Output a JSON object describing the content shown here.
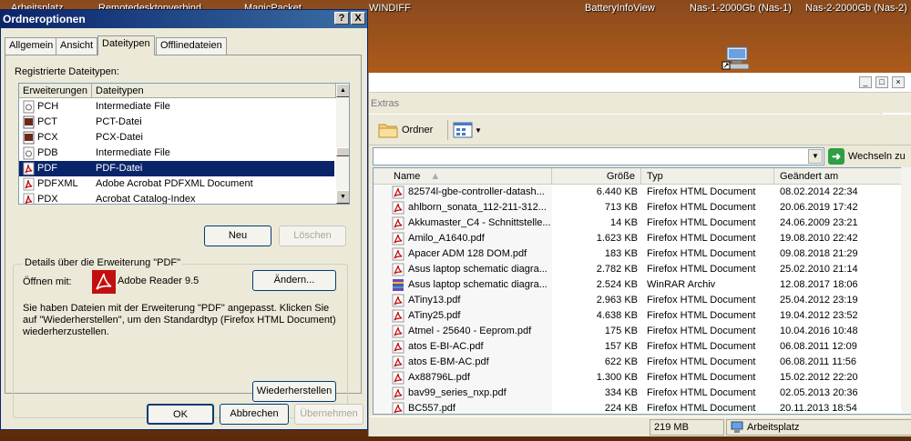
{
  "desktop": {
    "labels": [
      "Arbeitsplatz",
      "Remotedesktopverbind",
      "MagicPacket",
      "WINDIFF",
      "BatteryInfoView",
      "Nas-1-2000Gb (Nas-1)",
      "Nas-2-2000Gb (Nas-2)"
    ]
  },
  "explorer": {
    "menu_partial": "Extras",
    "toolbar": {
      "folders_label": "Ordner"
    },
    "address": {
      "go_label": "Wechseln zu"
    },
    "columns": {
      "name": "Name",
      "size": "Größe",
      "type": "Typ",
      "modified": "Geändert am"
    },
    "files": [
      {
        "name": "82574l-gbe-controller-datash...",
        "size": "6.440 KB",
        "type": "Firefox HTML Document",
        "modified": "08.02.2014 22:34",
        "icon": "pdf"
      },
      {
        "name": "ahlborn_sonata_112-211-312...",
        "size": "713 KB",
        "type": "Firefox HTML Document",
        "modified": "20.06.2019 17:42",
        "icon": "pdf"
      },
      {
        "name": "Akkumaster_C4 - Schnittstelle...",
        "size": "14 KB",
        "type": "Firefox HTML Document",
        "modified": "24.06.2009 23:21",
        "icon": "pdf"
      },
      {
        "name": "Amilo_A1640.pdf",
        "size": "1.623 KB",
        "type": "Firefox HTML Document",
        "modified": "19.08.2010 22:42",
        "icon": "pdf"
      },
      {
        "name": "Apacer ADM 128 DOM.pdf",
        "size": "183 KB",
        "type": "Firefox HTML Document",
        "modified": "09.08.2018 21:29",
        "icon": "pdf"
      },
      {
        "name": "Asus laptop schematic diagra...",
        "size": "2.782 KB",
        "type": "Firefox HTML Document",
        "modified": "25.02.2010 21:14",
        "icon": "pdf"
      },
      {
        "name": "Asus laptop schematic diagra...",
        "size": "2.524 KB",
        "type": "WinRAR Archiv",
        "modified": "12.08.2017 18:06",
        "icon": "rar"
      },
      {
        "name": "ATiny13.pdf",
        "size": "2.963 KB",
        "type": "Firefox HTML Document",
        "modified": "25.04.2012 23:19",
        "icon": "pdf"
      },
      {
        "name": "ATiny25.pdf",
        "size": "4.638 KB",
        "type": "Firefox HTML Document",
        "modified": "19.04.2012 23:52",
        "icon": "pdf"
      },
      {
        "name": "Atmel - 25640 - Eeprom.pdf",
        "size": "175 KB",
        "type": "Firefox HTML Document",
        "modified": "10.04.2016 10:48",
        "icon": "pdf"
      },
      {
        "name": "atos E-BI-AC.pdf",
        "size": "157 KB",
        "type": "Firefox HTML Document",
        "modified": "06.08.2011 12:09",
        "icon": "pdf"
      },
      {
        "name": "atos E-BM-AC.pdf",
        "size": "622 KB",
        "type": "Firefox HTML Document",
        "modified": "06.08.2011 11:56",
        "icon": "pdf"
      },
      {
        "name": "Ax88796L.pdf",
        "size": "1.300 KB",
        "type": "Firefox HTML Document",
        "modified": "15.02.2012 22:20",
        "icon": "pdf"
      },
      {
        "name": "bav99_series_nxp.pdf",
        "size": "334 KB",
        "type": "Firefox HTML Document",
        "modified": "02.05.2013 20:36",
        "icon": "pdf"
      },
      {
        "name": "BC557.pdf",
        "size": "224 KB",
        "type": "Firefox HTML Document",
        "modified": "20.11.2013 18:54",
        "icon": "pdf"
      }
    ],
    "status": {
      "size": "219 MB",
      "location": "Arbeitsplatz"
    }
  },
  "dialog": {
    "title": "Ordneroptionen",
    "help_btn": "?",
    "close_btn": "X",
    "tabs": [
      "Allgemein",
      "Ansicht",
      "Dateitypen",
      "Offlinedateien"
    ],
    "registered_label": "Registrierte Dateitypen:",
    "list_columns": {
      "ext": "Erweiterungen",
      "type": "Dateitypen"
    },
    "filetypes": [
      {
        "ext": "PCH",
        "type": "Intermediate File"
      },
      {
        "ext": "PCT",
        "type": "PCT-Datei"
      },
      {
        "ext": "PCX",
        "type": "PCX-Datei"
      },
      {
        "ext": "PDB",
        "type": "Intermediate File"
      },
      {
        "ext": "PDF",
        "type": "PDF-Datei",
        "selected": true
      },
      {
        "ext": "PDFXML",
        "type": "Adobe Acrobat PDFXML Document"
      },
      {
        "ext": "PDX",
        "type": "Acrobat Catalog-Index"
      }
    ],
    "new_btn": "Neu",
    "delete_btn": "Löschen",
    "details_legend": "Details über die Erweiterung \"PDF\"",
    "opens_with_label": "Öffnen mit:",
    "opens_with_app": "Adobe Reader 9.5",
    "change_btn": "Ändern...",
    "description": "Sie haben Dateien mit der Erweiterung \"PDF\" angepasst. Klicken Sie auf \"Wiederherstellen\", um den Standardtyp (Firefox HTML Document) wiederherzustellen.",
    "restore_btn": "Wiederherstellen",
    "ok_btn": "OK",
    "cancel_btn": "Abbrechen",
    "apply_btn": "Übernehmen"
  }
}
